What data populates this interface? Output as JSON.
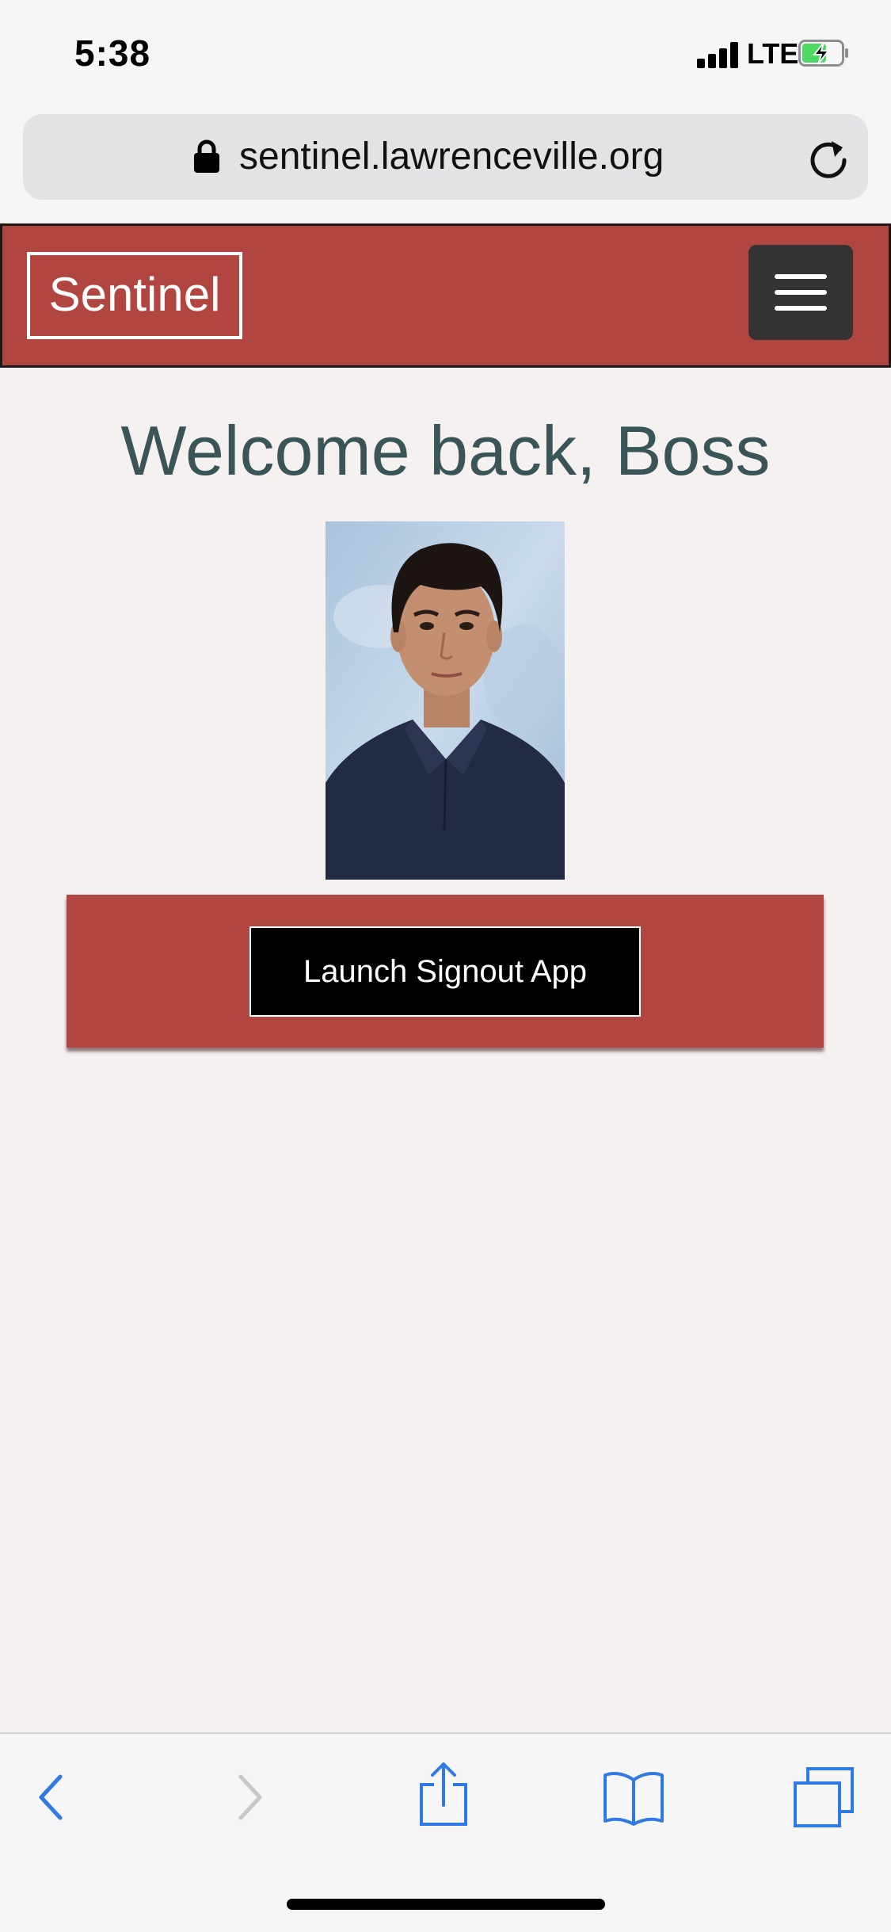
{
  "status_bar": {
    "time": "5:38",
    "network": "LTE",
    "icons": [
      "signal-icon",
      "battery-charging-icon"
    ]
  },
  "browser": {
    "url": "sentinel.lawrenceville.org",
    "icons": [
      "lock-icon",
      "reload-icon"
    ]
  },
  "navbar": {
    "brand": "Sentinel",
    "menu_icon": "hamburger-menu-icon",
    "color": "#b14640"
  },
  "main": {
    "welcome": "Welcome back, Boss",
    "photo": "student-portrait",
    "launch_button": "Launch Signout App"
  },
  "toolbar": {
    "icons": [
      "back-icon",
      "forward-icon",
      "share-icon",
      "bookmarks-icon",
      "tabs-icon"
    ],
    "accent": "#2f7ae5"
  }
}
